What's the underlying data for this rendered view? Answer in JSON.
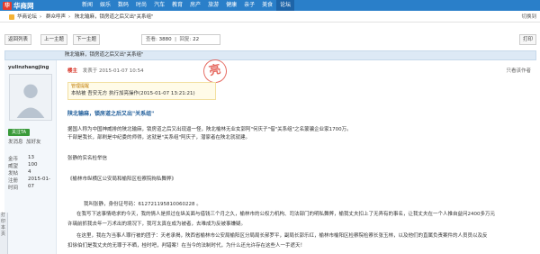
{
  "site": {
    "logo_mark": "华",
    "logo_text": "华商网",
    "nav": [
      "新闻",
      "娱乐",
      "数码",
      "时尚",
      "汽车",
      "教育",
      "房产",
      "旅游",
      "健康",
      "亲子",
      "美食",
      "论坛"
    ],
    "active_nav": "论坛"
  },
  "breadcrumb": [
    "华商论坛",
    "群众呼声",
    "陕北输麻，锁房道之后又出\"关系组\""
  ],
  "breadcrumb_right": "切换到",
  "toolbar": {
    "back": "返回列表",
    "prev": "上一主题",
    "next": "下一主题",
    "views_label": "查看:",
    "views": "3880",
    "replies_label": "回复:",
    "replies": "22",
    "page_btn": "打印"
  },
  "post_header_title": "陕北输麻，锁房道之后又出\"关系组\"",
  "author": {
    "name": "yulinzhangjing",
    "follow": "关注TA",
    "badge": "关注TA",
    "status_line1": "发消息",
    "status_line2": "加好友",
    "stats": [
      {
        "k": "金币",
        "v": "13"
      },
      {
        "k": "威望",
        "v": "100"
      },
      {
        "k": "发帖",
        "v": "4"
      },
      {
        "k": "注册",
        "v": "2015-01-"
      },
      {
        "k": "时间",
        "v": "07"
      }
    ],
    "scroll_label": "打印本页"
  },
  "post": {
    "who": "楼主",
    "time": "发表于 2015-01-07 10:54",
    "floor": "只看该作者",
    "stamp": "亮",
    "notice_title": "管理提醒",
    "notice_body": "本帖被 吾安无方 执行加亮操作(2015-01-07 13:21:21)",
    "title": "陕北输麻，锁房道之后又出\"关系组\"",
    "lines": [
      "据国人称为中国神威排的陕北输麻，锁房道之后又出现逼一怪，陕北榆林无业女郭阿\"何庆子\"借\"关系组\"之名蒙骗企业家1700万。",
      "干部是我长，部刷是中纪委的师得，这就是\"关系组\"阿庆子，潜家者在陕北就就建。",
      "",
      "张静的实名检举信",
      "",
      "《榆林市纵横区公安局和榆阳区检察院徇私舞弊》",
      "",
      "我叫张静，身份证号码：612721195810060228 。",
      "在我写下这事情绝求的今天，我的情人是抓过在纵关面与借钱三个月之久，榆林市的公权力机构、司法部门的明私舞弊，榆我丈夫扣上了无弄有的事名，让我丈夫在一个人推自益问2400多万元",
      "许璃前抓我去年一万术出的境况下，我可太真在成为被者，去难成为反被事嫌疑。",
      "在这里，我在为当事人罪行被的团子：天老承揭，陕西省榆林市公安局榆阳区分局局长郝罗平，副局长郭乐红，榆林市榆阳区检察院检察长张玉林，以及他们的直属负责案件的人员员以及反",
      "扣徐伯们是我丈夫的无罪于不晒，桂时吧，判错案！在当今的法制时代，为什么还允许存在这些人一手遮天！"
    ]
  }
}
